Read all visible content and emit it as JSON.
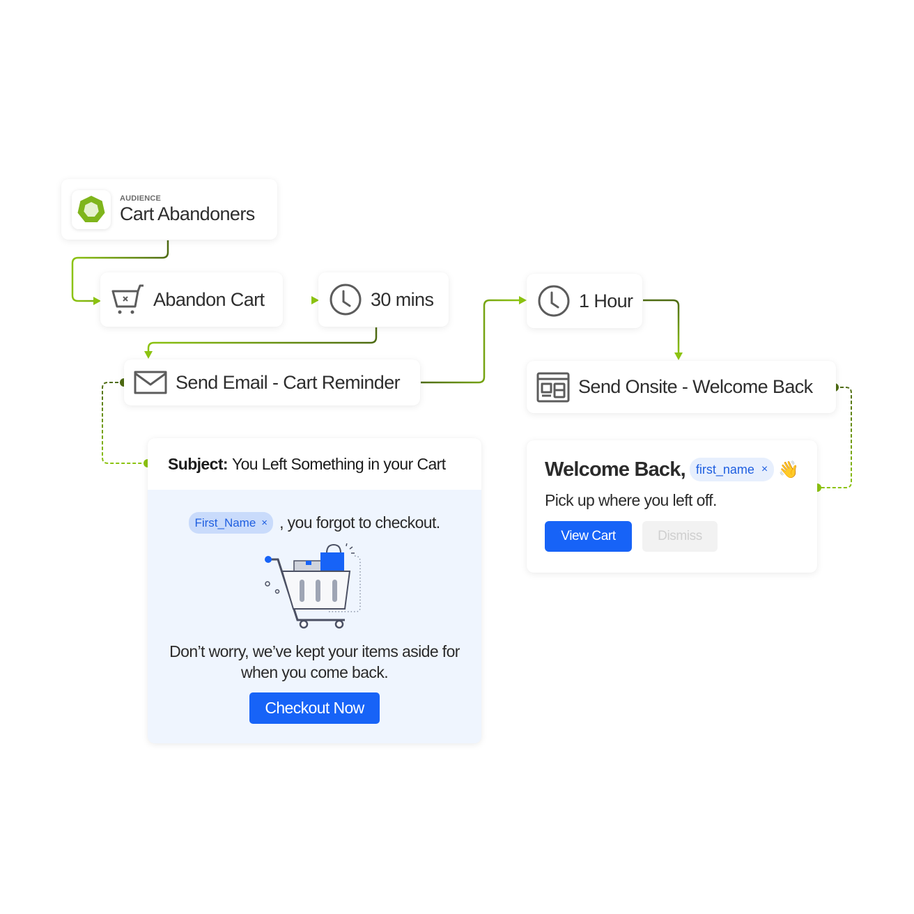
{
  "audience": {
    "kicker": "AUDIENCE",
    "title": "Cart Abandoners",
    "icon": "heptagon-audience-icon"
  },
  "nodes": {
    "abandon_cart": {
      "label": "Abandon Cart",
      "icon": "cart-x-icon"
    },
    "wait_30": {
      "label": "30 mins",
      "icon": "clock-icon"
    },
    "send_email": {
      "label": "Send Email - Cart Reminder",
      "icon": "envelope-icon"
    },
    "wait_1h": {
      "label": "1 Hour",
      "icon": "clock-icon"
    },
    "send_onsite": {
      "label": "Send Onsite - Welcome Back",
      "icon": "layout-window-icon"
    }
  },
  "email_preview": {
    "subject_label": "Subject:",
    "subject": "You Left Something in your Cart",
    "token": "First_Name",
    "token_remove": "×",
    "greeting": ", you forgot to checkout.",
    "body": "Don’t worry, we’ve kept your items aside for when you come back.",
    "cta": "Checkout Now"
  },
  "onsite_preview": {
    "title": "Welcome Back,",
    "token": "first_name",
    "token_remove": "×",
    "emoji": "👋",
    "subtitle": "Pick up where you left off.",
    "primary_button": "View Cart",
    "secondary_button": "Dismiss"
  },
  "colors": {
    "wire_light": "#8cc311",
    "wire_dark": "#4e6b12",
    "primary_blue": "#1763f7",
    "email_bg": "#eff5fe"
  }
}
